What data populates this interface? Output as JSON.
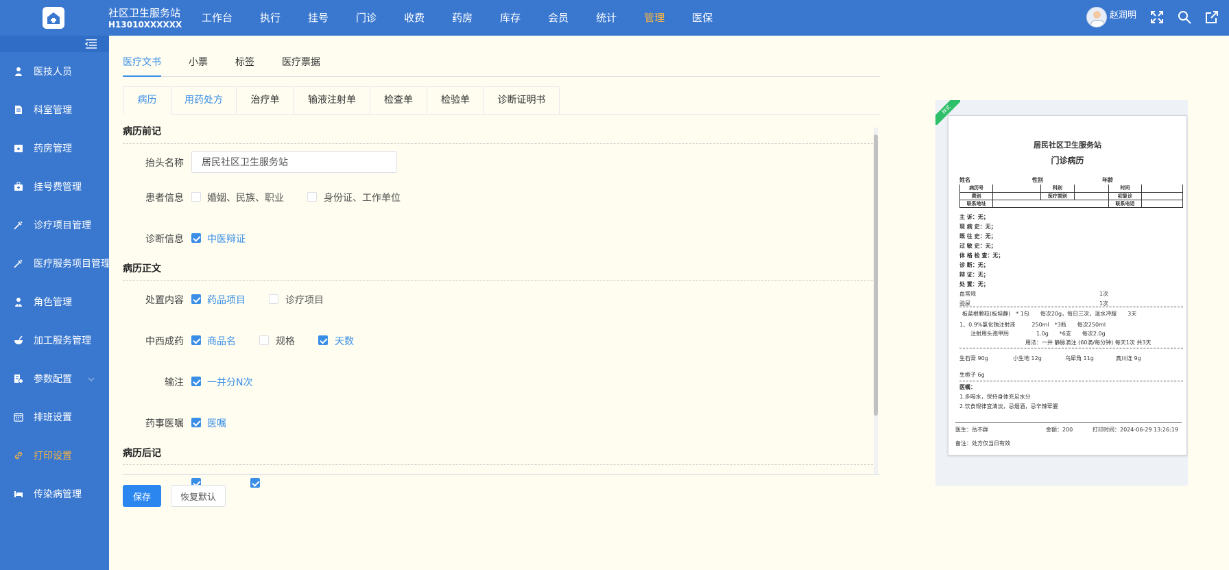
{
  "header": {
    "org_name": "社区卫生服务站",
    "org_code": "H13010XXXXXX",
    "nav": [
      "工作台",
      "执行",
      "挂号",
      "门诊",
      "收费",
      "药房",
      "库存",
      "会员",
      "统计",
      "管理",
      "医保"
    ],
    "active_nav": "管理",
    "user_name": "赵润明"
  },
  "sidebar": {
    "items": [
      {
        "label": "医技人员",
        "icon": "person-icon"
      },
      {
        "label": "科室管理",
        "icon": "document-icon"
      },
      {
        "label": "药房管理",
        "icon": "pharmacy-icon"
      },
      {
        "label": "挂号费管理",
        "icon": "medical-kit-icon"
      },
      {
        "label": "诊疗项目管理",
        "icon": "syringe-icon"
      },
      {
        "label": "医疗服务项目管理",
        "icon": "syringe-icon"
      },
      {
        "label": "角色管理",
        "icon": "role-icon"
      },
      {
        "label": "加工服务管理",
        "icon": "bowl-icon"
      },
      {
        "label": "参数配置",
        "icon": "settings-doc-icon"
      },
      {
        "label": "排班设置",
        "icon": "calendar-icon"
      },
      {
        "label": "打印设置",
        "icon": "link-icon"
      },
      {
        "label": "传染病管理",
        "icon": "bed-icon"
      }
    ],
    "active_item": "打印设置"
  },
  "top_tabs": [
    "医疗文书",
    "小票",
    "标签",
    "医疗票据"
  ],
  "active_top_tab": "医疗文书",
  "sub_tabs": [
    "病历",
    "用药处方",
    "治疗单",
    "输液注射单",
    "检查单",
    "检验单",
    "诊断证明书"
  ],
  "active_sub_tab": "病历",
  "form": {
    "section_pre": "病历前记",
    "header_name_label": "抬头名称",
    "header_name_value": "居民社区卫生服务站",
    "patient_info_label": "患者信息",
    "patient_opt1": "婚姻、民族、职业",
    "patient_opt2": "身份证、工作单位",
    "diagnosis_label": "诊断信息",
    "diagnosis_opt1": "中医辩证",
    "section_body": "病历正文",
    "treatment_label": "处置内容",
    "treatment_opt1": "药品项目",
    "treatment_opt2": "诊疗项目",
    "medicine_label": "中西成药",
    "medicine_opt1": "商品名",
    "medicine_opt2": "规格",
    "medicine_opt3": "天数",
    "infusion_label": "输注",
    "infusion_opt1": "一并分N次",
    "advice_label": "药事医嘱",
    "advice_opt1": "医嘱",
    "section_post": "病历后记",
    "save_label": "保存",
    "reset_label": "恢复默认"
  },
  "checkbox_states": {
    "patient_opt1": false,
    "patient_opt2": false,
    "diagnosis_opt1": true,
    "treatment_opt1": true,
    "treatment_opt2": false,
    "medicine_opt1": true,
    "medicine_opt2": false,
    "medicine_opt3": true,
    "infusion_opt1": true,
    "advice_opt1": true,
    "post_opt1": true,
    "post_opt2": true
  },
  "preview": {
    "ribbon": "样式",
    "clinic": "居民社区卫生服务站",
    "doc_title": "门诊病历",
    "name_label": "姓名",
    "gender_label": "性别",
    "age_label": "年龄",
    "table_labels": [
      "病历号",
      "科别",
      "时间",
      "费别",
      "医疗类别",
      "初复诊",
      "联系地址",
      "联系电话"
    ],
    "fields": [
      "主 诉：无；",
      "现 病 史：无；",
      "既 往 史：无；",
      "过 敏 史：无；",
      "体 格 检 查：无；",
      "诊 断：无；",
      "辩 证：无；",
      "处 置：无；"
    ],
    "items": [
      {
        "name": "血常规",
        "qty": "1次"
      },
      {
        "name": "验尿",
        "qty": "1次"
      }
    ],
    "rx1": "板蓝根颗粒(板坦静)　* 1包　　每次20g，每日三次，温水冲服　　3天",
    "rx2_line1": "1、0.9%氯化钠注射液　　　250ml　*3瓶　　每次250ml",
    "rx2_line2": "注射用头孢甲肟　　　　　1.0g　　*6支　　每次2.0g",
    "rx2_line3": "用法：一并 静脉滴注 (60滴/每分钟) 每天1次 共3天",
    "herbs_line1": [
      "生石膏 90g",
      "小生地 12g",
      "乌犀角 11g",
      "真川连 9g"
    ],
    "herbs_line2": "生栀子 6g",
    "advice_title": "医嘱：",
    "advice_1": "1.多喝水，保持身体充足水分",
    "advice_2": "2.饮食规律宜清淡，忌烟酒，忌辛辣荤腥",
    "doctor": "医生：岳不群",
    "amount": "金额：200",
    "print_time": "打印时间：2024-06-29 13:26:19",
    "note": "备注：处方仅当日有效"
  },
  "colors": {
    "primary": "#3a78d0",
    "accent": "#f5b342",
    "link_blue": "#3a8ee6",
    "page_bg": "#fefdf0"
  }
}
